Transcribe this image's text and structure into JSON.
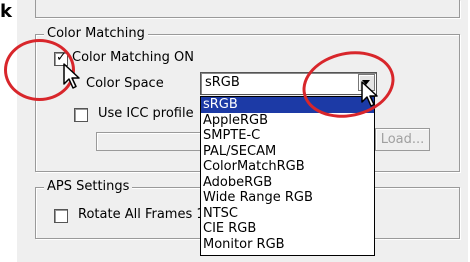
{
  "top_letter": "k",
  "color_matching": {
    "group_title": "Color Matching",
    "on_label": "Color Matching ON",
    "on_checked": true,
    "color_space_label": "Color Space",
    "color_space_value": "sRGB",
    "use_icc_label": "Use ICC profile",
    "use_icc_checked": false,
    "load_button": "Load...",
    "color_space_options": [
      "sRGB",
      "AppleRGB",
      "SMPTE-C",
      "PAL/SECAM",
      "ColorMatchRGB",
      "AdobeRGB",
      "Wide Range RGB",
      "NTSC",
      "CIE RGB",
      "Monitor RGB"
    ],
    "selected_option": "sRGB"
  },
  "aps": {
    "group_title": "APS Settings",
    "rotate_label": "Rotate All Frames 1",
    "rotate_checked": false
  },
  "colors": {
    "highlight": "#1c3aa6",
    "annotation_circle": "#d8262b",
    "panel": "#efefef"
  }
}
